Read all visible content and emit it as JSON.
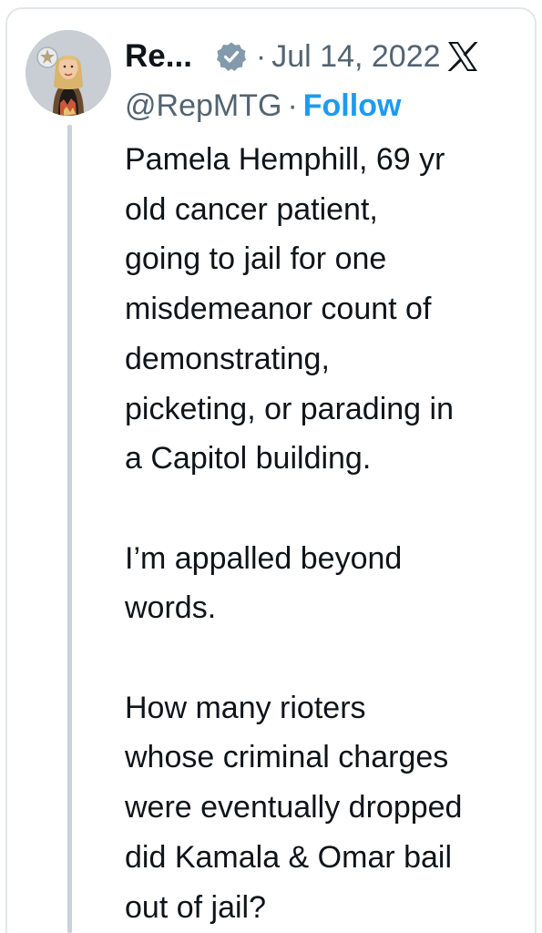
{
  "tweet": {
    "author_name": "Re...",
    "handle": "@RepMTG",
    "date": "Jul 14, 2022",
    "separator": "·",
    "follow_label": "Follow",
    "text": "Pamela Hemphill, 69 yr\nold cancer patient,\ngoing to jail for one\nmisdemeanor count of\ndemonstrating,\npicketing, or parading in\na Capitol building.\n\nI’m appalled beyond\nwords.\n\nHow many rioters\nwhose criminal charges\nwere eventually dropped\ndid Kamala & Omar bail\nout of jail?"
  },
  "icons": {
    "verified": "verified-badge-icon",
    "platform": "x-logo-icon"
  },
  "colors": {
    "text": "#0f1419",
    "muted": "#536471",
    "link": "#1d9bf0",
    "thread_line": "#c9d2db",
    "border": "#e3e6e9"
  }
}
